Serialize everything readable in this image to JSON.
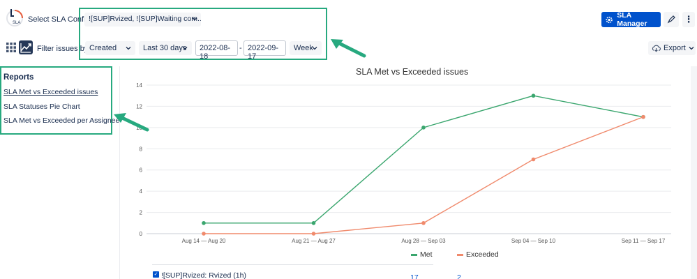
{
  "header": {
    "logo_text": "SLA",
    "config_label": "Select SLA Config",
    "config_value": "![SUP]Rvized, ![SUP]Waiting com...",
    "sla_manager_label": "SLA Manager"
  },
  "filters": {
    "label": "Filter issues by:",
    "field": "Created",
    "range": "Last 30 days",
    "date_from": "2022-08-18",
    "date_separator": "-",
    "date_to": "2022-09-17",
    "granularity": "Week",
    "export_label": "Export"
  },
  "sidebar": {
    "title": "Reports",
    "items": [
      {
        "label": "SLA Met vs Exceeded issues",
        "active": true
      },
      {
        "label": "SLA Statuses Pie Chart",
        "active": false
      },
      {
        "label": "SLA Met vs Exceeded per Assignee",
        "active": false
      }
    ]
  },
  "chart_data": {
    "type": "line",
    "title": "SLA Met vs Exceeded issues",
    "categories": [
      "Aug 14 — Aug 20",
      "Aug 21 — Aug 27",
      "Aug 28 — Sep 03",
      "Sep 04 — Sep 10",
      "Sep 11 — Sep 17"
    ],
    "series": [
      {
        "name": "Met",
        "color": "#3aa66e",
        "values": [
          1,
          1,
          10,
          13,
          11
        ]
      },
      {
        "name": "Exceeded",
        "color": "#f08a6c",
        "values": [
          0,
          0,
          1,
          7,
          11
        ]
      }
    ],
    "ylim": [
      0,
      14
    ],
    "yticks": [
      0,
      2,
      4,
      6,
      8,
      10,
      12,
      14
    ],
    "grid": true,
    "legend_position": "bottom-center"
  },
  "table": {
    "rows": [
      {
        "label": "![SUP]Rvized: Rvized (1h)",
        "met": "17",
        "exceeded": "2",
        "checked": true
      }
    ]
  },
  "colors": {
    "accent": "#0052cc",
    "highlight": "#27a97f"
  }
}
